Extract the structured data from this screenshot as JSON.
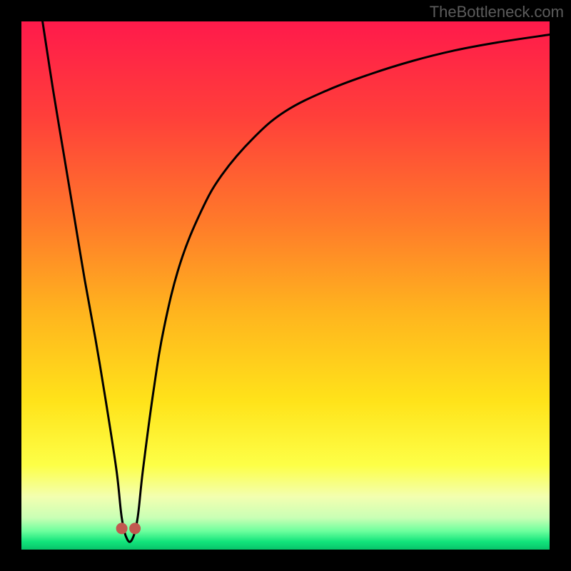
{
  "watermark": "TheBottleneck.com",
  "chart_data": {
    "type": "line",
    "title": "",
    "xlabel": "",
    "ylabel": "",
    "xlim": [
      0,
      100
    ],
    "ylim": [
      0,
      100
    ],
    "grid": false,
    "legend": false,
    "background_gradient_stops": [
      {
        "pos": 0.0,
        "color": "#ff1a4b"
      },
      {
        "pos": 0.18,
        "color": "#ff3f3a"
      },
      {
        "pos": 0.38,
        "color": "#ff7a2a"
      },
      {
        "pos": 0.55,
        "color": "#ffb41e"
      },
      {
        "pos": 0.72,
        "color": "#ffe31a"
      },
      {
        "pos": 0.84,
        "color": "#fdff47"
      },
      {
        "pos": 0.9,
        "color": "#f3ffb0"
      },
      {
        "pos": 0.94,
        "color": "#c9ffb5"
      },
      {
        "pos": 0.965,
        "color": "#6dff9d"
      },
      {
        "pos": 0.985,
        "color": "#12e47b"
      },
      {
        "pos": 1.0,
        "color": "#08c46a"
      }
    ],
    "series": [
      {
        "name": "bottleneck-curve",
        "x": [
          4,
          6,
          8,
          10,
          12,
          14,
          16,
          18,
          19,
          20,
          21,
          22,
          23,
          25,
          27,
          30,
          34,
          38,
          44,
          50,
          58,
          66,
          74,
          82,
          90,
          100
        ],
        "y": [
          100,
          87,
          75,
          63,
          51,
          40,
          28,
          15,
          6,
          2,
          2,
          6,
          15,
          30,
          42,
          54,
          64,
          71,
          78,
          83,
          87,
          90,
          92.5,
          94.5,
          96,
          97.5
        ]
      }
    ],
    "markers": [
      {
        "name": "min-left",
        "x": 19.0,
        "y": 4.0,
        "color": "#c1584f",
        "r": 8
      },
      {
        "name": "min-right",
        "x": 21.5,
        "y": 4.0,
        "color": "#c1584f",
        "r": 8
      }
    ]
  }
}
